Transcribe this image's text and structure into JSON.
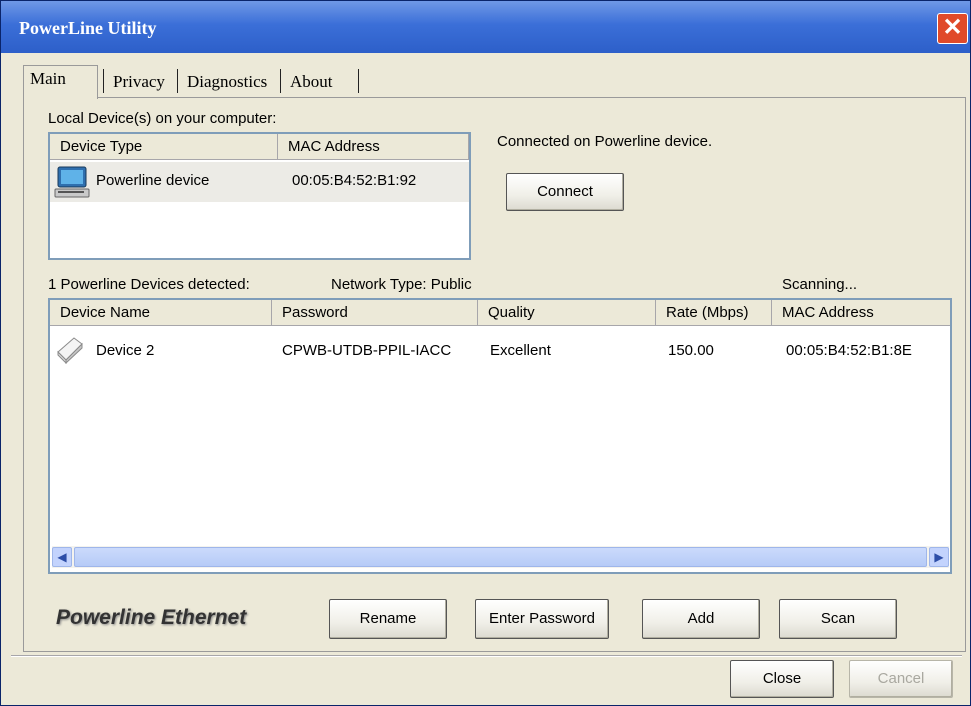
{
  "window": {
    "title": "PowerLine Utility",
    "close_glyph": "✕"
  },
  "tabs": [
    {
      "label": "Main"
    },
    {
      "label": "Privacy"
    },
    {
      "label": "Diagnostics"
    },
    {
      "label": "About"
    }
  ],
  "local": {
    "label": "Local Device(s) on your computer:",
    "columns": [
      "Device Type",
      "MAC Address"
    ],
    "rows": [
      {
        "icon": "computer-icon",
        "type": "Powerline device",
        "mac": "00:05:B4:52:B1:92"
      }
    ]
  },
  "connection": {
    "status": "Connected on Powerline device.",
    "connect_label": "Connect"
  },
  "detected": {
    "count_label": "1 Powerline Devices detected:",
    "network_type": "Network Type: Public",
    "scan_status": "Scanning..."
  },
  "devices": {
    "columns": [
      "Device Name",
      "Password",
      "Quality",
      "Rate (Mbps)",
      "MAC Address"
    ],
    "rows": [
      {
        "icon": "device-icon",
        "name": "Device 2",
        "password": "CPWB-UTDB-PPIL-IACC",
        "quality": "Excellent",
        "rate": "150.00",
        "mac": "00:05:B4:52:B1:8E"
      }
    ]
  },
  "actions": {
    "rename": "Rename",
    "enter_password": "Enter Password",
    "add": "Add",
    "scan": "Scan"
  },
  "brand": "Powerline Ethernet",
  "footer": {
    "close": "Close",
    "cancel": "Cancel"
  },
  "colors": {
    "titlebar": "#2d5fc9",
    "window_bg": "#ece9d8",
    "close_button": "#e04a2a"
  }
}
